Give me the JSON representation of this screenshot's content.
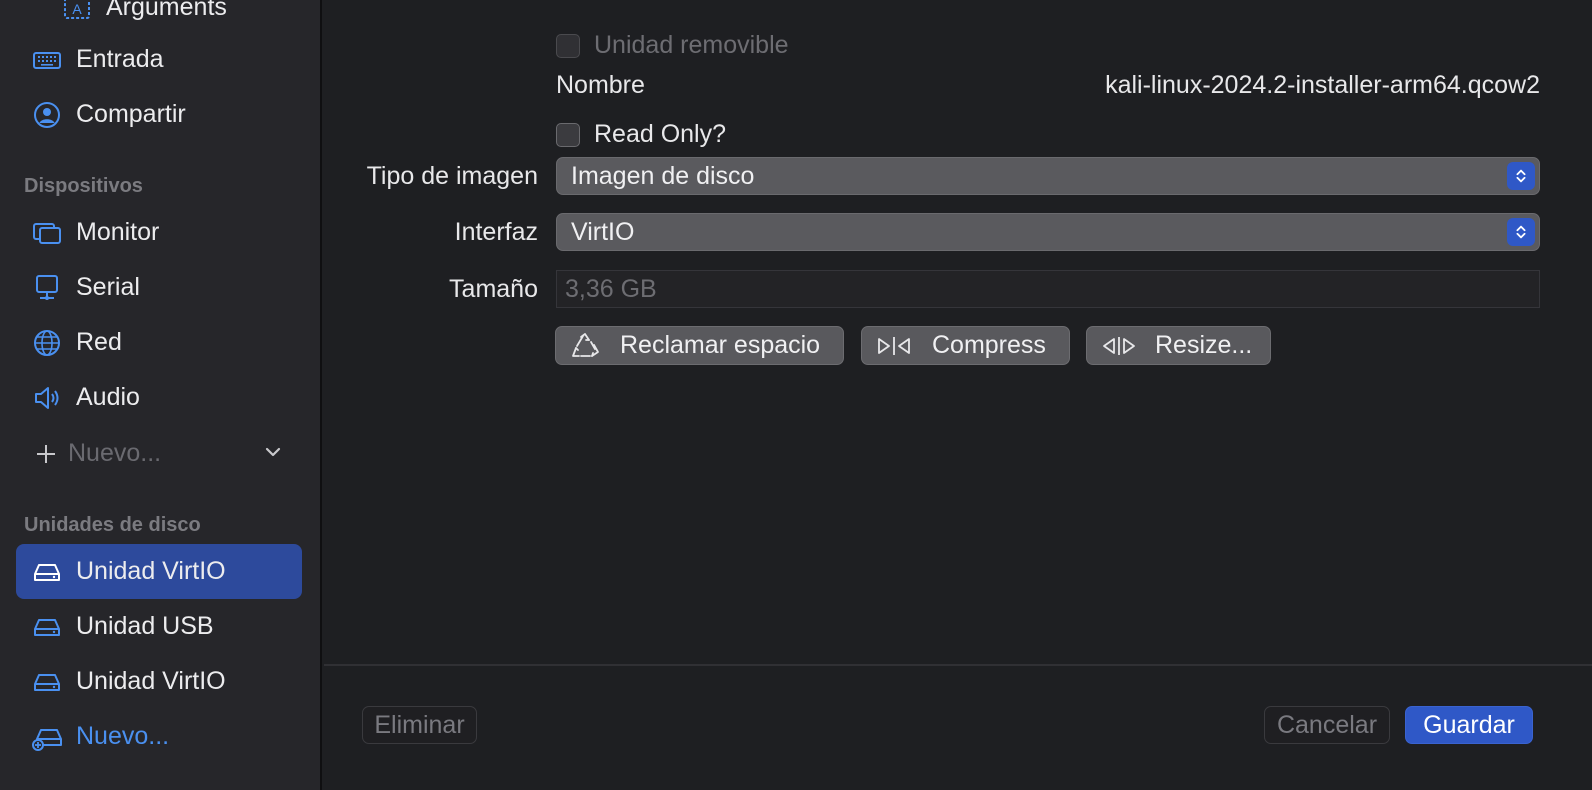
{
  "sidebar": {
    "top_partial_item": {
      "label": "Arguments",
      "icon": "text-field-icon"
    },
    "items_input": [
      {
        "label": "Entrada",
        "icon": "keyboard-icon"
      },
      {
        "label": "Compartir",
        "icon": "person-circle-icon"
      }
    ],
    "devices_header": "Dispositivos",
    "devices": [
      {
        "label": "Monitor",
        "icon": "display-icon"
      },
      {
        "label": "Serial",
        "icon": "terminal-display-icon"
      },
      {
        "label": "Red",
        "icon": "globe-icon"
      },
      {
        "label": "Audio",
        "icon": "speaker-icon"
      }
    ],
    "new_device": {
      "label": "Nuevo...",
      "icon": "plus-icon"
    },
    "drives_header": "Unidades de disco",
    "drives": [
      {
        "label": "Unidad VirtIO",
        "icon": "drive-icon",
        "selected": true
      },
      {
        "label": "Unidad USB",
        "icon": "drive-icon",
        "selected": false
      },
      {
        "label": "Unidad VirtIO",
        "icon": "drive-icon",
        "selected": false
      }
    ],
    "new_drive": {
      "label": "Nuevo...",
      "icon": "drive-add-icon"
    }
  },
  "form": {
    "removable_label": "Unidad removible",
    "name_label": "Nombre",
    "name_value": "kali-linux-2024.2-installer-arm64.qcow2",
    "read_only_label": "Read Only?",
    "image_type_label": "Tipo de imagen",
    "image_type_value": "Imagen de disco",
    "interface_label": "Interfaz",
    "interface_value": "VirtIO",
    "size_label": "Tamaño",
    "size_value": "3,36 GB",
    "buttons": [
      {
        "label": "Reclamar espacio",
        "icon": "recycle-icon"
      },
      {
        "label": "Compress",
        "icon": "compress-icon"
      },
      {
        "label": "Resize...",
        "icon": "resize-icon"
      }
    ]
  },
  "footer": {
    "delete_label": "Eliminar",
    "cancel_label": "Cancelar",
    "save_label": "Guardar"
  },
  "colors": {
    "accent": "#2f58c7",
    "selected_bg": "#2d4a9c",
    "link": "#4a90f0"
  }
}
